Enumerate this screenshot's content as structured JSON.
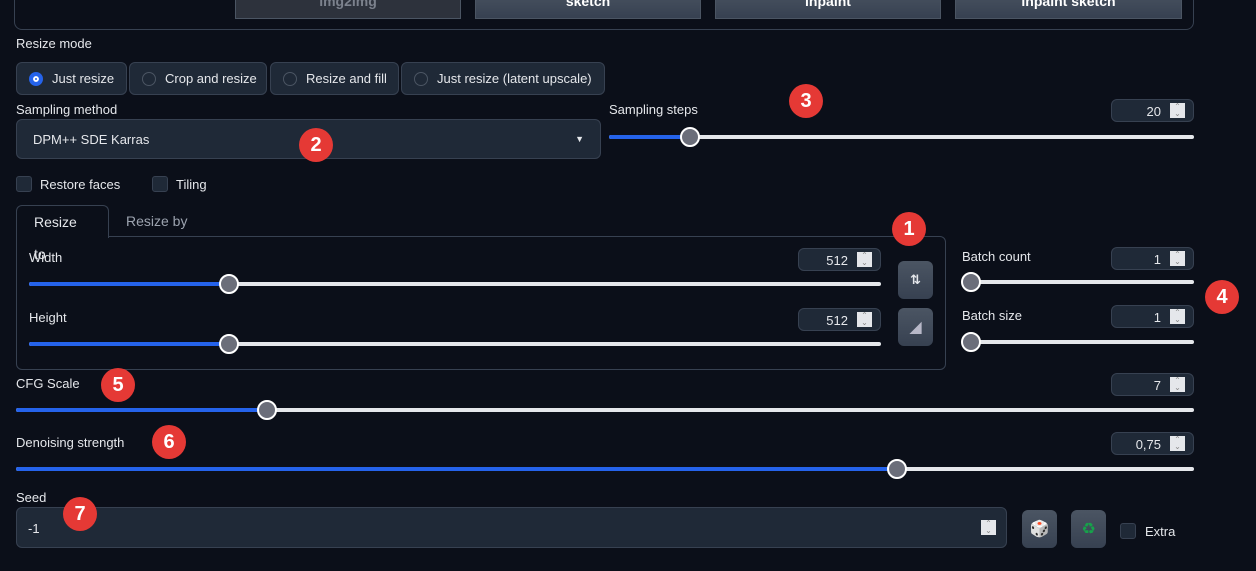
{
  "mode_tabs": [
    "img2img",
    "sketch",
    "inpaint",
    "inpaint sketch"
  ],
  "resize_mode": {
    "label": "Resize mode",
    "options": [
      "Just resize",
      "Crop and resize",
      "Resize and fill",
      "Just resize (latent upscale)"
    ],
    "selected": "Just resize"
  },
  "sampling_method": {
    "label": "Sampling method",
    "value": "DPM++ SDE Karras"
  },
  "sampling_steps": {
    "label": "Sampling steps",
    "value": "20",
    "min": 1,
    "max": 150
  },
  "checkboxes": {
    "restore_faces": "Restore faces",
    "tiling": "Tiling"
  },
  "size_tabs": [
    "Resize to",
    "Resize by"
  ],
  "width": {
    "label": "Width",
    "value": "512",
    "min": 64,
    "max": 2048
  },
  "height": {
    "label": "Height",
    "value": "512",
    "min": 64,
    "max": 2048
  },
  "batch_count": {
    "label": "Batch count",
    "value": "1",
    "min": 1,
    "max": 100
  },
  "batch_size": {
    "label": "Batch size",
    "value": "1",
    "min": 1,
    "max": 8
  },
  "cfg_scale": {
    "label": "CFG Scale",
    "value": "7",
    "min": 1,
    "max": 30
  },
  "denoising": {
    "label": "Denoising strength",
    "value": "0,75",
    "fraction": 0.75
  },
  "seed": {
    "label": "Seed",
    "value": "-1"
  },
  "extra": {
    "label": "Extra"
  },
  "icons": {
    "swap": "swap-arrows-icon",
    "ratio": "triangle-ruler-icon",
    "dice": "dice-icon",
    "recycle": "recycle-icon"
  },
  "badges": [
    "1",
    "2",
    "3",
    "4",
    "5",
    "6",
    "7"
  ],
  "colors": {
    "accent": "#2563eb",
    "badge": "#e53935",
    "background": "#0b0f19"
  }
}
